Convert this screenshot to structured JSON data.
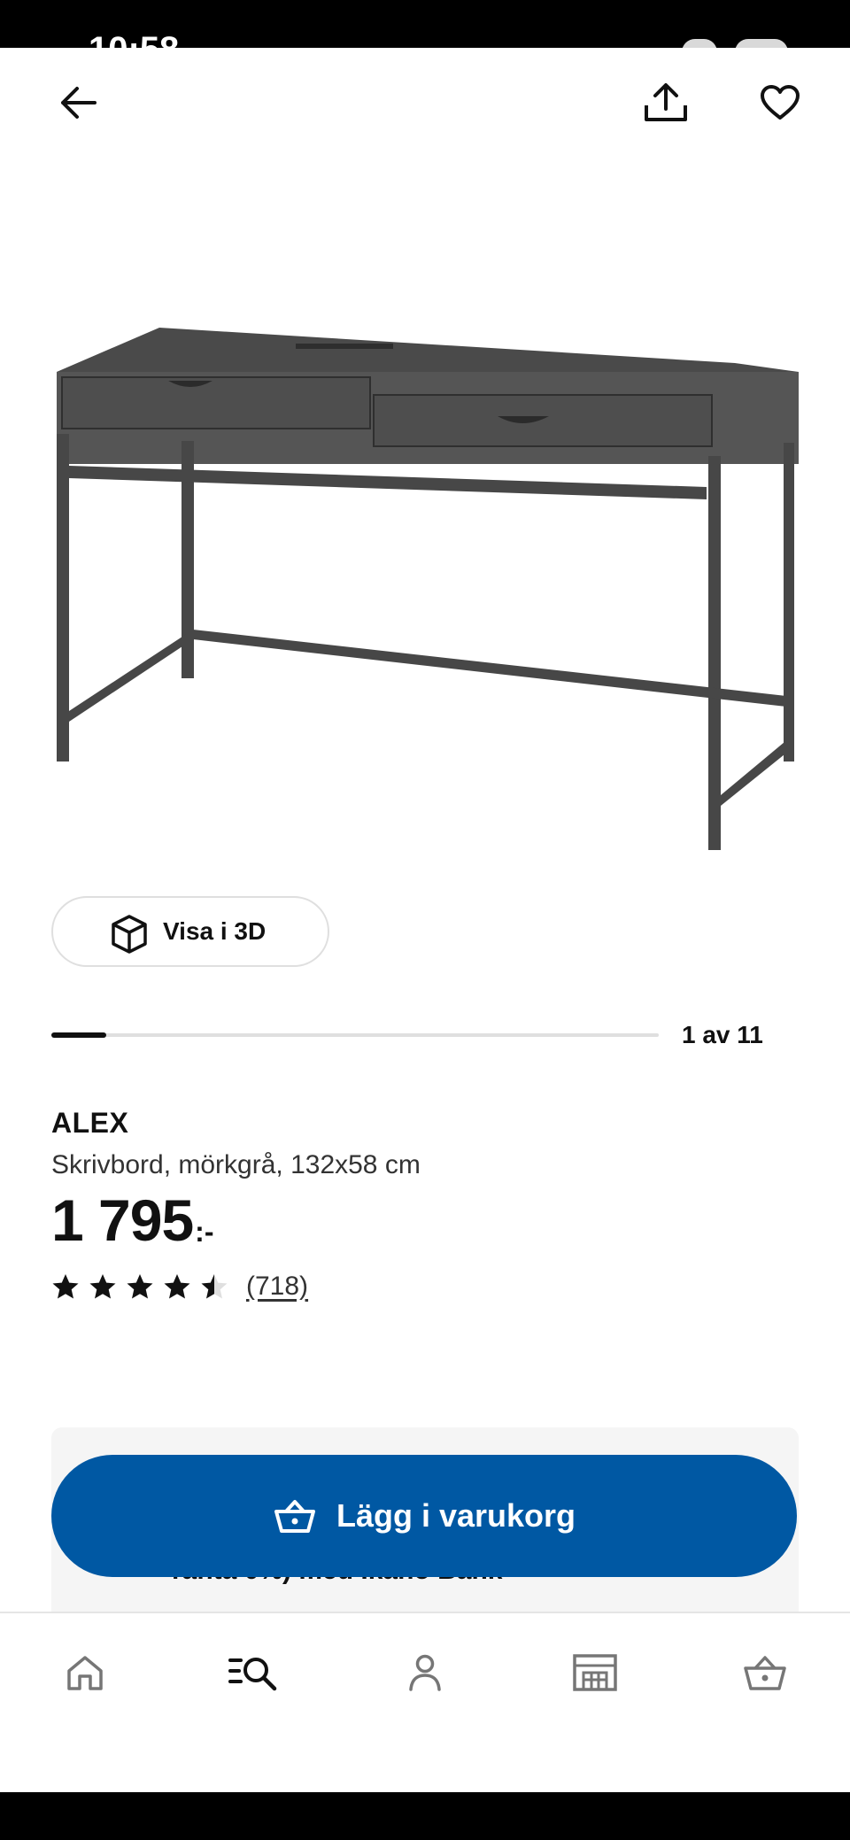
{
  "status_bar": {
    "time": "10:58"
  },
  "header": {
    "back_icon": "arrow-left-icon",
    "share_icon": "share-icon",
    "favorite_icon": "heart-icon"
  },
  "gallery": {
    "image_alt": "ALEX Skrivbord, mörkgrå",
    "view_3d_label": "Visa i 3D",
    "page_indicator": "1 av 11",
    "progress": 0.09
  },
  "product": {
    "name": "ALEX",
    "description": "Skrivbord, mörkgrå, 132x58 cm",
    "price": "1 795",
    "price_suffix": ":-",
    "rating": 4.5,
    "rating_max": 5,
    "review_count": "(718)"
  },
  "cart": {
    "add_button_label": "Lägg i varukorg",
    "financing_text": "räntа 0%) med Ikano Bank"
  },
  "bottom_nav": {
    "items": [
      "home-icon",
      "search-list-icon",
      "profile-icon",
      "store-icon",
      "cart-icon"
    ],
    "active": "search-list-icon"
  },
  "colors": {
    "brand_blue": "#0058a3",
    "text": "#111111"
  }
}
